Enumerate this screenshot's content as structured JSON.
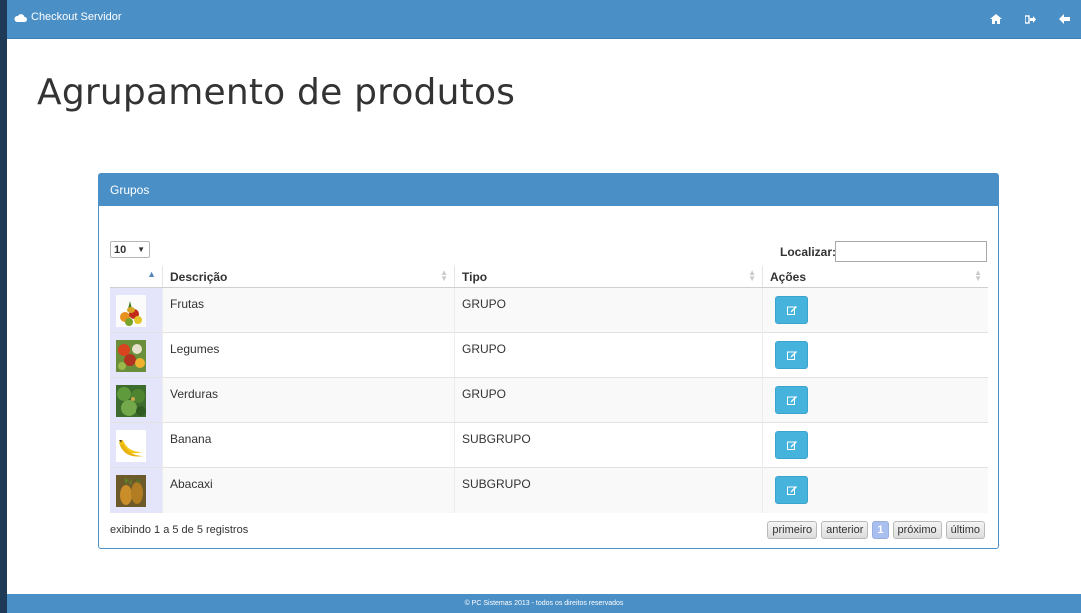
{
  "app": {
    "brand": "Checkout Servidor"
  },
  "nav": {
    "icons": [
      "home-icon",
      "sign-out-icon",
      "back-arrow-icon"
    ]
  },
  "page": {
    "title": "Agrupamento de produtos"
  },
  "panel": {
    "heading": "Grupos"
  },
  "controls": {
    "length_value": "10",
    "search_label": "Localizar:",
    "search_value": ""
  },
  "table": {
    "headers": {
      "descricao": "Descrição",
      "tipo": "Tipo",
      "acoes": "Ações"
    },
    "rows": [
      {
        "image": "fruits",
        "descricao": "Frutas",
        "tipo": "GRUPO"
      },
      {
        "image": "vegetables",
        "descricao": "Legumes",
        "tipo": "GRUPO"
      },
      {
        "image": "greens",
        "descricao": "Verduras",
        "tipo": "GRUPO"
      },
      {
        "image": "banana",
        "descricao": "Banana",
        "tipo": "SUBGRUPO"
      },
      {
        "image": "pineapple",
        "descricao": "Abacaxi",
        "tipo": "SUBGRUPO"
      }
    ]
  },
  "pagination": {
    "info": "exibindo 1 a 5 de 5 registros",
    "first": "primeiro",
    "previous": "anterior",
    "current": "1",
    "next": "próximo",
    "last": "último"
  },
  "footer": {
    "text": "© PC Sistemas 2013 - todos os direitos reservados"
  },
  "colors": {
    "primary": "#4a8fc6",
    "edit_button": "#46b3dc",
    "image_cell": "#e4e4fb"
  }
}
